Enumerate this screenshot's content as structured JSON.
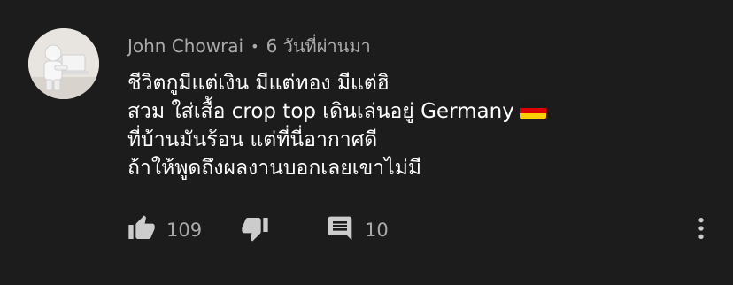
{
  "comment": {
    "author": "John Chowrai",
    "separator": "•",
    "time": "6 วันที่ผ่านมา",
    "lines": [
      "ชีวิตกูมีแต่เงิน มีแต่ทอง มีแต่ฮิ",
      "สวม ใส่เสื้อ crop top เดินเล่นอยู่ Germany",
      "ที่บ้านมันร้อน แต่ที่นี่อากาศดี",
      "ถ้าให้พูดถึงผลงานบอกเลยเขาไม่มี"
    ],
    "flag_icon": "germany-flag",
    "like_count": "109",
    "reply_count": "10"
  },
  "colors": {
    "background": "#1c1c1c",
    "text_primary": "#ffffff",
    "text_secondary": "#aaaaaa",
    "icon": "#cccccc"
  },
  "icons": {
    "like": "thumbs-up-icon",
    "dislike": "thumbs-down-icon",
    "reply": "comment-icon",
    "menu": "more-vertical-icon"
  }
}
